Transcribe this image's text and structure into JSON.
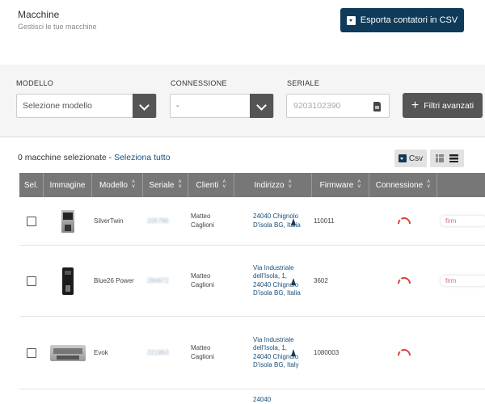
{
  "header": {
    "title": "Macchine",
    "subtitle": "Gestisci le tue macchine",
    "export_label": "Esporta contatori in CSV"
  },
  "filters": {
    "model_label": "MODELLO",
    "model_value": "Selezione modello",
    "connection_label": "CONNESSIONE",
    "connection_value": "-",
    "serial_label": "SERIALE",
    "serial_placeholder": "9203102390",
    "advanced_label": "Filtri avanzati"
  },
  "selection": {
    "count_text": "0 macchine selezionate - ",
    "select_all": "Seleziona tutto",
    "csv_label": "Csv"
  },
  "table": {
    "columns": [
      "Sel.",
      "Immagine",
      "Modello",
      "Seriale",
      "Clienti",
      "Indirizzo",
      "Firmware",
      "Connessione"
    ],
    "rows": [
      {
        "model": "SilverTwin",
        "serial": "205786",
        "client": "Matteo Caglioni",
        "address": "24040 Chignolo D'isola BG, Italia",
        "firmware": "110011",
        "badge": "firm"
      },
      {
        "model": "Blue26 Power",
        "serial": "284872",
        "client": "Matteo Caglioni",
        "address": "Via Industriale dell'Isola, 1, 24040 Chignolo D'isola BG, Italia",
        "firmware": "3602",
        "badge": "firm"
      },
      {
        "model": "Evok",
        "serial": "221863",
        "client": "Matteo Caglioni",
        "address": "Via Industriale dell'Isola, 1, 24040 Chignolo D'isola BG, Italy",
        "firmware": "1080003",
        "badge": ""
      },
      {
        "model": "",
        "serial": "",
        "client": "",
        "address": "24040",
        "firmware": "",
        "badge": ""
      }
    ]
  },
  "colors": {
    "primary": "#0f3a5a",
    "header_bg": "#777777",
    "link": "#1a4f7a",
    "connection_off": "#d9413a"
  }
}
